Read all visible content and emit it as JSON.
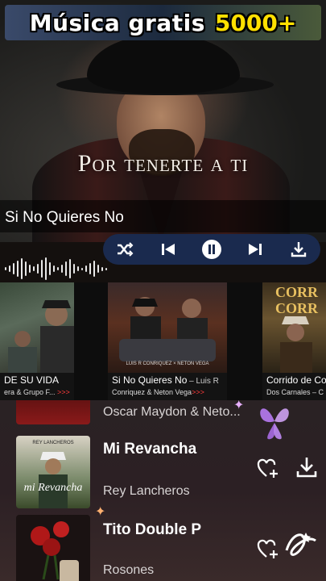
{
  "banner": {
    "title": "Música gratis",
    "badge": "5000+"
  },
  "video": {
    "lyric": "Por tenerte a ti"
  },
  "player": {
    "now_playing": "Si No Quieres No",
    "controls": [
      "shuffle-icon",
      "previous-icon",
      "pause-icon",
      "next-icon",
      "download-icon"
    ]
  },
  "carousel": [
    {
      "title": "DE SU VIDA",
      "artist": "era & Grupo F...",
      "more": ">>>"
    },
    {
      "title": "Si No Quieres No",
      "title_suffix": " – Luis R",
      "artist": "Conriquez & Neton Vega",
      "more": ">>>"
    },
    {
      "title": "Corrido de Co",
      "artist": "Dos Carnales – C",
      "art_text": [
        "CORR",
        "CORR"
      ]
    }
  ],
  "list": [
    {
      "title": "",
      "artist": "Oscar Maydon & Neto..."
    },
    {
      "title": "Mi Revancha",
      "artist": "Rey Lancheros",
      "thumb_text": "REY LANCHEROS"
    },
    {
      "title": "Tito Double P",
      "artist": "Rosones"
    }
  ],
  "colors": {
    "accent_red": "#ff3b3b",
    "control_bar": "#1a2a4e",
    "badge_yellow": "#ffe000"
  }
}
